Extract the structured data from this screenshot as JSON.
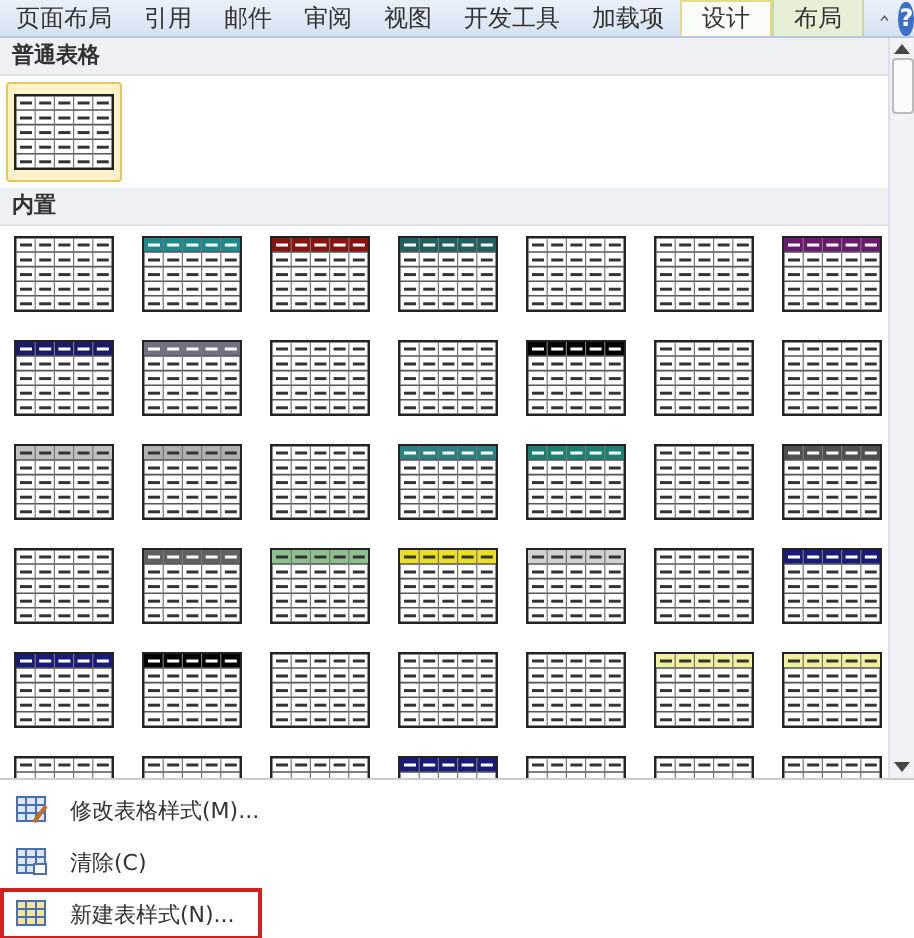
{
  "tabs": [
    {
      "label": "页面布局",
      "selected": false,
      "kind": "normal"
    },
    {
      "label": "引用",
      "selected": false,
      "kind": "normal"
    },
    {
      "label": "邮件",
      "selected": false,
      "kind": "normal"
    },
    {
      "label": "审阅",
      "selected": false,
      "kind": "normal"
    },
    {
      "label": "视图",
      "selected": false,
      "kind": "normal"
    },
    {
      "label": "开发工具",
      "selected": false,
      "kind": "normal"
    },
    {
      "label": "加载项",
      "selected": false,
      "kind": "normal"
    },
    {
      "label": "设计",
      "selected": true,
      "kind": "context"
    },
    {
      "label": "布局",
      "selected": false,
      "kind": "context"
    }
  ],
  "help_label": "?",
  "gallery": {
    "sections": [
      {
        "title": "普通表格",
        "styles": [
          {
            "selected": true
          }
        ]
      },
      {
        "title": "内置",
        "styles": [
          {
            "selected": false
          },
          {
            "selected": false,
            "color": "#1a8a8a"
          },
          {
            "selected": false,
            "color": "#8b1010"
          },
          {
            "selected": false,
            "color": "#1e5f5f"
          },
          {
            "selected": false
          },
          {
            "selected": false
          },
          {
            "selected": false,
            "color": "#6a1a6a"
          },
          {
            "selected": false,
            "color": "#1a1a6a"
          },
          {
            "selected": false,
            "color": "#707080"
          },
          {
            "selected": false
          },
          {
            "selected": false
          },
          {
            "selected": false,
            "color": "#000000"
          },
          {
            "selected": false
          },
          {
            "selected": false
          },
          {
            "selected": false,
            "color": "#c0c0c0"
          },
          {
            "selected": false,
            "color": "#b0b0b0"
          },
          {
            "selected": false
          },
          {
            "selected": false,
            "color": "#2a8080"
          },
          {
            "selected": false,
            "color": "#1a8070"
          },
          {
            "selected": false
          },
          {
            "selected": false,
            "color": "#505050"
          },
          {
            "selected": false
          },
          {
            "selected": false,
            "color": "#606060"
          },
          {
            "selected": false,
            "color": "#8fbf8f"
          },
          {
            "selected": false,
            "color": "#e8e020"
          },
          {
            "selected": false,
            "color": "#d0d0d0"
          },
          {
            "selected": false
          },
          {
            "selected": false,
            "color": "#1a1a7a"
          },
          {
            "selected": false,
            "color": "#1a1a7a"
          },
          {
            "selected": false,
            "color": "#000000"
          },
          {
            "selected": false
          },
          {
            "selected": false
          },
          {
            "selected": false
          },
          {
            "selected": false,
            "color": "#f0f0a0"
          },
          {
            "selected": false,
            "color": "#f0f0a0"
          },
          {
            "selected": false
          },
          {
            "selected": false
          },
          {
            "selected": false
          },
          {
            "selected": false,
            "color": "#1a1a7a"
          },
          {
            "selected": false
          },
          {
            "selected": false
          },
          {
            "selected": false
          }
        ]
      }
    ]
  },
  "menu": [
    {
      "label": "修改表格样式(M)...",
      "highlighted": false,
      "kind": "modify"
    },
    {
      "label": "清除(C)",
      "highlighted": false,
      "kind": "clear"
    },
    {
      "label": "新建表样式(N)...",
      "highlighted": true,
      "kind": "new"
    }
  ]
}
